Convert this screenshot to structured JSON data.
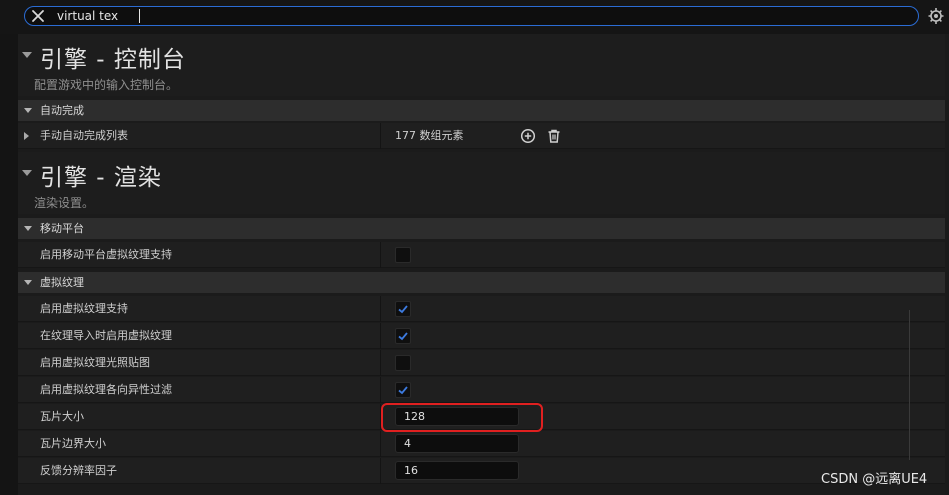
{
  "search": {
    "value": "virtual tex"
  },
  "sections": [
    {
      "title": "引擎 - 控制台",
      "description": "配置游戏中的输入控制台。"
    },
    {
      "title": "引擎 - 渲染",
      "description": "渲染设置。"
    }
  ],
  "categories": {
    "autocomplete": "自动完成",
    "mobile": "移动平台",
    "virtual_texture": "虚拟纹理"
  },
  "rows": {
    "manual_autocomplete": {
      "label": "手动自动完成列表",
      "value": "177 数组元素"
    },
    "mobile_vt_support": {
      "label": "启用移动平台虚拟纹理支持",
      "checked": false
    },
    "vt_support": {
      "label": "启用虚拟纹理支持",
      "checked": true
    },
    "vt_on_import": {
      "label": "在纹理导入时启用虚拟纹理",
      "checked": true
    },
    "vt_lightmaps": {
      "label": "启用虚拟纹理光照贴图",
      "checked": false
    },
    "vt_anisotropic": {
      "label": "启用虚拟纹理各向异性过滤",
      "checked": true
    },
    "tile_size": {
      "label": "瓦片大小",
      "value": "128"
    },
    "tile_border": {
      "label": "瓦片边界大小",
      "value": "4"
    },
    "feedback_factor": {
      "label": "反馈分辨率因子",
      "value": "16"
    }
  },
  "watermark": "CSDN @远离UE4",
  "colors": {
    "accent": "#2b6cd4",
    "check": "#3d7be0",
    "highlight": "#e02020"
  }
}
